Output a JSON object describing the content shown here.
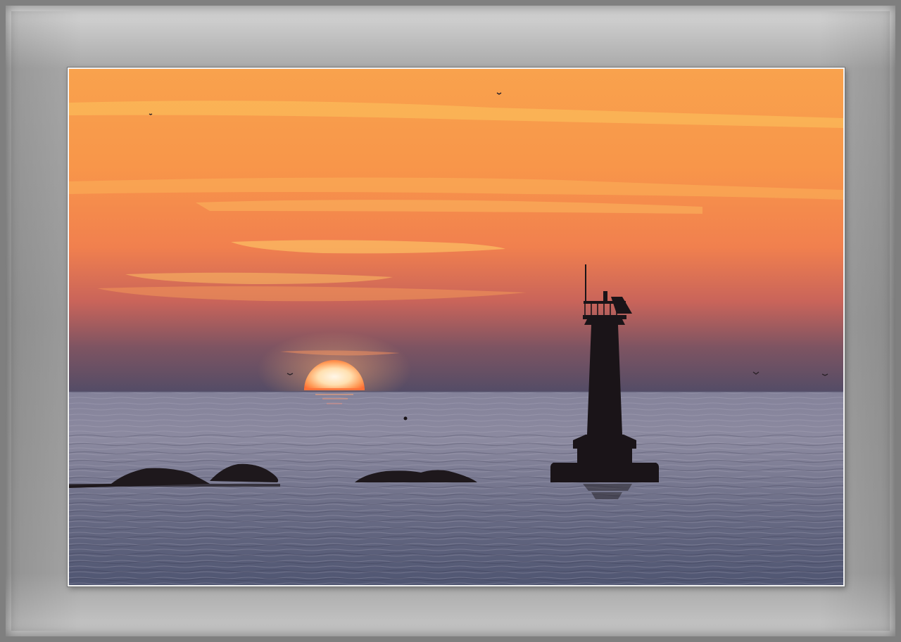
{
  "scene": {
    "subject": "lighthouse-at-sunset",
    "colors": {
      "sky_top": "#f9a24d",
      "sky_mid": "#f58a4c",
      "sky_low": "#c9645a",
      "sky_horizon": "#5b4e66",
      "sun_core": "#fff3e0",
      "sun_edge": "#ff7a3a",
      "sea_far": "#7d7d9a",
      "sea_near": "#525670",
      "silhouette": "#1a1418"
    }
  }
}
